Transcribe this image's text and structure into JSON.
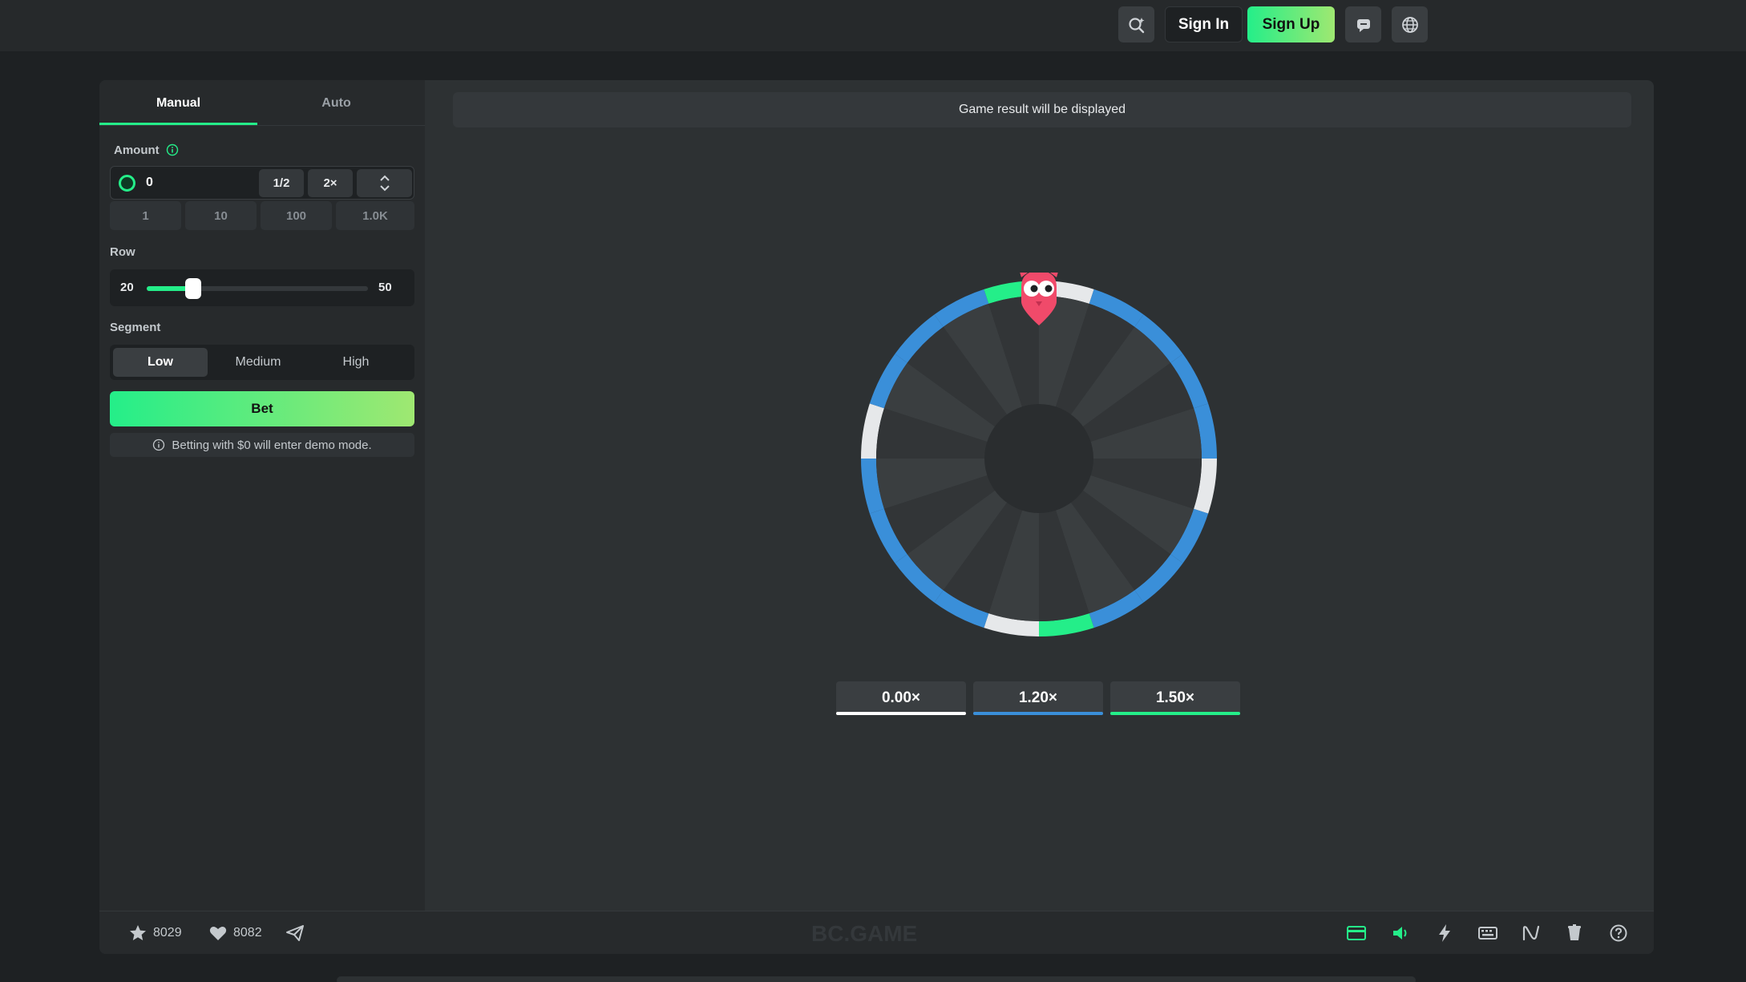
{
  "header": {
    "sign_in_label": "Sign In",
    "sign_up_label": "Sign Up",
    "icons": [
      "search-icon",
      "chat-icon",
      "globe-icon"
    ]
  },
  "sidebar": {
    "tabs": [
      {
        "label": "Manual",
        "active": true
      },
      {
        "label": "Auto",
        "active": false
      }
    ],
    "amount": {
      "label": "Amount",
      "value": "0",
      "half_label": "1/2",
      "double_label": "2×",
      "quick_amounts": [
        "1",
        "10",
        "100",
        "1.0K"
      ]
    },
    "row": {
      "label": "Row",
      "min_label": "20",
      "max_label": "50",
      "min": 20,
      "max": 50,
      "value": 20
    },
    "segment": {
      "label": "Segment",
      "options": [
        "Low",
        "Medium",
        "High"
      ],
      "selected": "Low"
    },
    "bet_label": "Bet",
    "demo_note": "Betting with $0 will enter demo mode."
  },
  "game": {
    "result_text": "Game result will be displayed",
    "segments_count": 20,
    "wheel_colors": {
      "blue": "#3a8fd9",
      "green": "#24ee89",
      "white": "#e6e8ea"
    },
    "multipliers": [
      {
        "label": "0.00×",
        "color": "#ffffff"
      },
      {
        "label": "1.20×",
        "color": "#3a8fd9"
      },
      {
        "label": "1.50×",
        "color": "#24ee89"
      }
    ]
  },
  "footer": {
    "favorites_count": "8029",
    "likes_count": "8082",
    "brand": "BC.GAME",
    "icons": [
      "card-icon",
      "sound-icon",
      "bolt-icon",
      "keyboard-icon",
      "chart-icon",
      "shield-icon",
      "help-icon"
    ]
  },
  "colors": {
    "accent": "#24ee89",
    "background": "#1e2123",
    "panel": "#2d3133"
  }
}
